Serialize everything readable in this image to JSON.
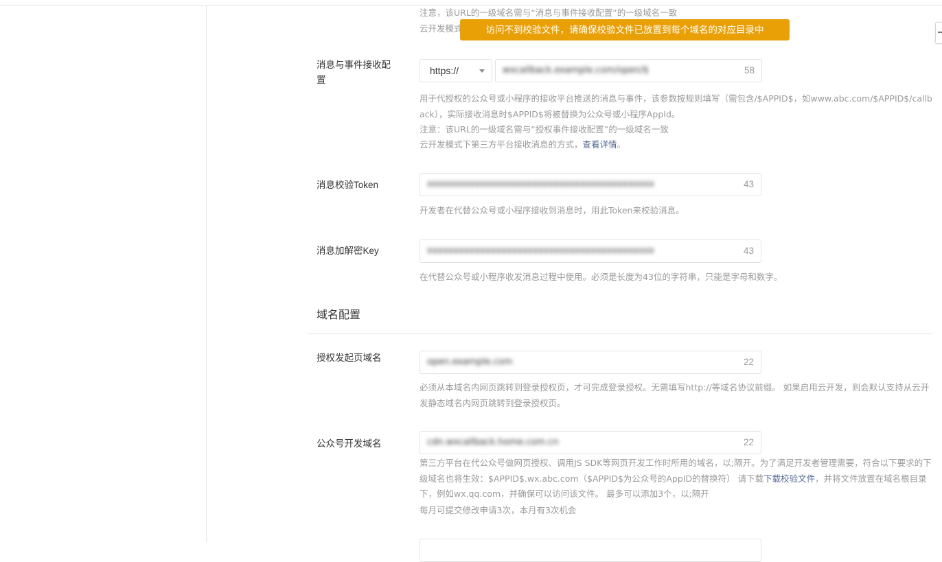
{
  "toast": {
    "text": "访问不到校验文件，请确保校验文件已放置到每个域名的对应目录中"
  },
  "top_tips": {
    "line1": "注意，该URL的一级域名需与“消息与事件接收配置”的一级域名一致",
    "line2": "云开发模式"
  },
  "msg_event": {
    "label": "消息与事件接收配置",
    "protocol": "https://",
    "value": "wxcallback.example.com/open/$",
    "count": "58",
    "tip1": "用于代授权的公众号或小程序的接收平台推送的消息与事件，该参数按规则填写（需包含/$APPID$，如www.abc.com/$APPID$/callback），实际接收消息时$APPID$将被替换为公众号或小程序AppId。",
    "tip2": "注意：该URL的一级域名需与“授权事件接收配置”的一级域名一致",
    "tip3_prefix": "云开发模式下第三方平台接收消息的方式，",
    "tip3_link": "查看详情",
    "tip3_suffix": "。"
  },
  "token": {
    "label": "消息校验Token",
    "value": "xxxxxxxxxxxxxxxxxxxxxxxxxxxxxxxxxxxxxxxxxxx",
    "count": "43",
    "tip": "开发者在代替公众号或小程序接收到消息时，用此Token来校验消息。"
  },
  "aes_key": {
    "label": "消息加解密Key",
    "value": "xxxxxxxxxxxxxxxxxxxxxxxxxxxxxxxxxxxxxxxxxxx",
    "count": "43",
    "tip": "在代替公众号或小程序收发消息过程中使用。必须是长度为43位的字符串，只能是字母和数字。"
  },
  "domain_section": {
    "title": "域名配置"
  },
  "auth_domain": {
    "label": "授权发起页域名",
    "value": "open.example.com",
    "count": "22",
    "tip": "必须从本域名内网页跳转到登录授权页，才可完成登录授权。无需填写http://等域名协议前缀。 如果启用云开发，则会默认支持从云开发静态域名内网页跳转到登录授权页。"
  },
  "mp_domain": {
    "label": "公众号开发域名",
    "value": "cdn.wxcallback.home.com.cn",
    "count": "22",
    "tip_prefix": "第三方平台在代公众号做网页授权、调用JS SDK等网页开发工作时所用的域名，以;隔开。为了满足开发者管理需要，符合以下要求的下级域名也将生效：$APPID$.wx.abc.com（$APPID$为公众号的AppID的替换符） 请下载",
    "tip_link": "下载校验文件",
    "tip_suffix": "，并将文件放置在域名根目录下，例如wx.qq.com，并确保可以访问该文件。 最多可以添加3个，以;隔开",
    "tip_line2": "每月可提交修改申请3次，本月有3次机会"
  }
}
